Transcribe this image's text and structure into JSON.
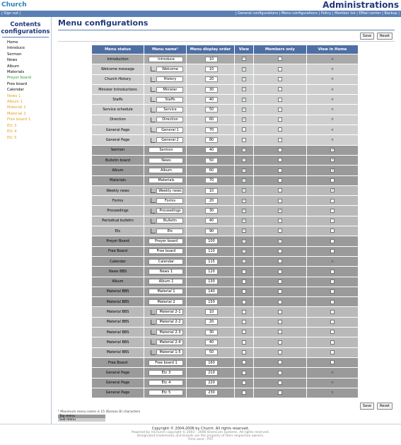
{
  "header": {
    "brand": "Church",
    "admin_title": "Administrations",
    "signout": "| Sign out |",
    "nav": [
      "| General configurations",
      "| Menu configurations",
      "| Policy",
      "| Member list",
      "| EMail center",
      "| Backup |"
    ]
  },
  "sidebar": {
    "title_line1": "Contents",
    "title_line2": "configurations",
    "items": [
      {
        "label": "Home",
        "color": "black"
      },
      {
        "label": "Introduce",
        "color": "black"
      },
      {
        "label": "Sermon",
        "color": "black"
      },
      {
        "label": "News",
        "color": "black"
      },
      {
        "label": "Album",
        "color": "black"
      },
      {
        "label": "Materials",
        "color": "black"
      },
      {
        "label": "Preyer board",
        "color": "green"
      },
      {
        "label": "Free board",
        "color": "black"
      },
      {
        "label": "Calendar",
        "color": "black"
      },
      {
        "label": "News 1",
        "color": "orange"
      },
      {
        "label": "Album 1",
        "color": "orange"
      },
      {
        "label": "Material 1",
        "color": "orange"
      },
      {
        "label": "Material 2",
        "color": "orange"
      },
      {
        "label": "Free board 1",
        "color": "orange"
      },
      {
        "label": "Etc 3",
        "color": "orange"
      },
      {
        "label": "Etc 4",
        "color": "orange"
      },
      {
        "label": "Etc 5",
        "color": "orange"
      }
    ]
  },
  "main": {
    "title": "Menu configurations",
    "save_label": "Save",
    "reset_label": "Reset",
    "columns": [
      "Menu status",
      "Menu name¹",
      "Menu display order",
      "View",
      "Members only",
      "View in Home"
    ],
    "rows": [
      {
        "group": "g2",
        "status": "Introduction",
        "sub": false,
        "name": "Introduce",
        "order": "10",
        "view": true,
        "members": false,
        "home": "x"
      },
      {
        "group": "g1",
        "status": "Welcome message",
        "sub": true,
        "name": "Welcome",
        "order": "10",
        "view": true,
        "members": false,
        "home": "x"
      },
      {
        "group": "g1",
        "status": "Church History",
        "sub": true,
        "name": "History",
        "order": "20",
        "view": true,
        "members": false,
        "home": "x"
      },
      {
        "group": "g1",
        "status": "Minister Introductions",
        "sub": true,
        "name": "Minister",
        "order": "30",
        "view": true,
        "members": false,
        "home": "x"
      },
      {
        "group": "g1",
        "status": "Staffs",
        "sub": true,
        "name": "Staffs",
        "order": "40",
        "view": true,
        "members": false,
        "home": "x"
      },
      {
        "group": "g1",
        "status": "Service schedule",
        "sub": true,
        "name": "Service",
        "order": "50",
        "view": true,
        "members": false,
        "home": "x"
      },
      {
        "group": "g1",
        "status": "Direction",
        "sub": true,
        "name": "Direction",
        "order": "60",
        "view": true,
        "members": false,
        "home": "x"
      },
      {
        "group": "g1",
        "status": "General Page",
        "sub": true,
        "name": "General 1",
        "order": "70",
        "view": false,
        "members": false,
        "home": "x"
      },
      {
        "group": "g1",
        "status": "General Page",
        "sub": true,
        "name": "General 2",
        "order": "80",
        "view": false,
        "members": false,
        "home": "x"
      },
      {
        "group": "g3",
        "status": "Sermon",
        "sub": false,
        "name": "Sermon",
        "order": "40",
        "view": true,
        "members": false,
        "home": "on"
      },
      {
        "group": "g3",
        "status": "Bulletin board",
        "sub": false,
        "name": "News",
        "order": "50",
        "view": true,
        "members": false,
        "home": "on"
      },
      {
        "group": "g3",
        "status": "Album",
        "sub": false,
        "name": "Album",
        "order": "60",
        "view": true,
        "members": false,
        "home": "on"
      },
      {
        "group": "g3",
        "status": "Materials",
        "sub": false,
        "name": "Materials",
        "order": "70",
        "view": true,
        "members": false,
        "home": "off"
      },
      {
        "group": "g4",
        "status": "Weekly news",
        "sub": true,
        "name": "Weekly news",
        "order": "10",
        "view": true,
        "members": false,
        "home": "on"
      },
      {
        "group": "g4",
        "status": "Forms",
        "sub": true,
        "name": "Forms",
        "order": "20",
        "view": true,
        "members": false,
        "home": "off"
      },
      {
        "group": "g4",
        "status": "Proceedings",
        "sub": true,
        "name": "Proceedings",
        "order": "30",
        "view": true,
        "members": true,
        "home": "off"
      },
      {
        "group": "g4",
        "status": "Periodical bulletin",
        "sub": true,
        "name": "Bulletin",
        "order": "40",
        "view": true,
        "members": false,
        "home": "off"
      },
      {
        "group": "g4",
        "status": "Etc",
        "sub": true,
        "name": "Etc",
        "order": "90",
        "view": true,
        "members": false,
        "home": "off"
      },
      {
        "group": "g3",
        "status": "Preyer Board",
        "sub": false,
        "name": "Preyer board",
        "order": "100",
        "view": true,
        "members": true,
        "home": "off"
      },
      {
        "group": "g3",
        "status": "Free Board",
        "sub": false,
        "name": "Free board",
        "order": "110",
        "view": true,
        "members": false,
        "home": "off"
      },
      {
        "group": "g3",
        "status": "Calendar",
        "sub": false,
        "name": "Calendar",
        "order": "115",
        "view": true,
        "members": false,
        "home": "x"
      },
      {
        "group": "g3",
        "status": "News BBS",
        "sub": false,
        "name": "News 1",
        "order": "120",
        "view": false,
        "members": false,
        "home": "off"
      },
      {
        "group": "g3",
        "status": "Album",
        "sub": false,
        "name": "Album 1",
        "order": "130",
        "view": false,
        "members": false,
        "home": "off"
      },
      {
        "group": "g3",
        "status": "Material BBS",
        "sub": false,
        "name": "Material 1",
        "order": "140",
        "view": false,
        "members": false,
        "home": "off"
      },
      {
        "group": "g3",
        "status": "Material BBS",
        "sub": false,
        "name": "Material 2",
        "order": "150",
        "view": false,
        "members": false,
        "home": "off"
      },
      {
        "group": "g4",
        "status": "Material BBS",
        "sub": true,
        "name": "Material 2-1",
        "order": "10",
        "view": false,
        "members": false,
        "home": "off"
      },
      {
        "group": "g4",
        "status": "Material BBS",
        "sub": true,
        "name": "Material 2-2",
        "order": "20",
        "view": false,
        "members": false,
        "home": "off"
      },
      {
        "group": "g4",
        "status": "Material BBS",
        "sub": true,
        "name": "Material 2-3",
        "order": "30",
        "view": false,
        "members": false,
        "home": "off"
      },
      {
        "group": "g4",
        "status": "Material BBS",
        "sub": true,
        "name": "Material 2-4",
        "order": "40",
        "view": false,
        "members": false,
        "home": "off"
      },
      {
        "group": "g4",
        "status": "Material BBS",
        "sub": true,
        "name": "Material 1-5",
        "order": "50",
        "view": false,
        "members": false,
        "home": "off"
      },
      {
        "group": "g3",
        "status": "Free Board",
        "sub": false,
        "name": "Free board 1",
        "order": "160",
        "view": false,
        "members": false,
        "home": "off"
      },
      {
        "group": "g3",
        "status": "General Page",
        "sub": false,
        "name": "Etc 3",
        "order": "210",
        "view": false,
        "members": false,
        "home": "x"
      },
      {
        "group": "g3",
        "status": "General Page",
        "sub": false,
        "name": "Etc 4",
        "order": "220",
        "view": false,
        "members": false,
        "home": "x"
      },
      {
        "group": "g3",
        "status": "General Page",
        "sub": false,
        "name": "Etc 5",
        "order": "230",
        "view": false,
        "members": false,
        "home": "x"
      }
    ],
    "footnote": "¹ Maximum menu name is 15 (Korean 8) characters",
    "legend_top": "Top menu",
    "legend_sub": "Sub menu"
  },
  "footer": {
    "copyright": "Copyright © 2004-2006 by Church. All rights reserved.",
    "powered": "Powered by mChurch copyright © 2003 - 2006 OnenCom Systems. All rights reserved.",
    "trademarks": "Designated trademarks and brands are the property of their respective owners.",
    "time": "Time zone : PST"
  },
  "colors": {
    "accent": "#223a7a",
    "navbar": "#5a7fb5",
    "table_header": "#4e6fa3",
    "green_text": "#2a9a2a",
    "orange_text": "#e0a020"
  }
}
